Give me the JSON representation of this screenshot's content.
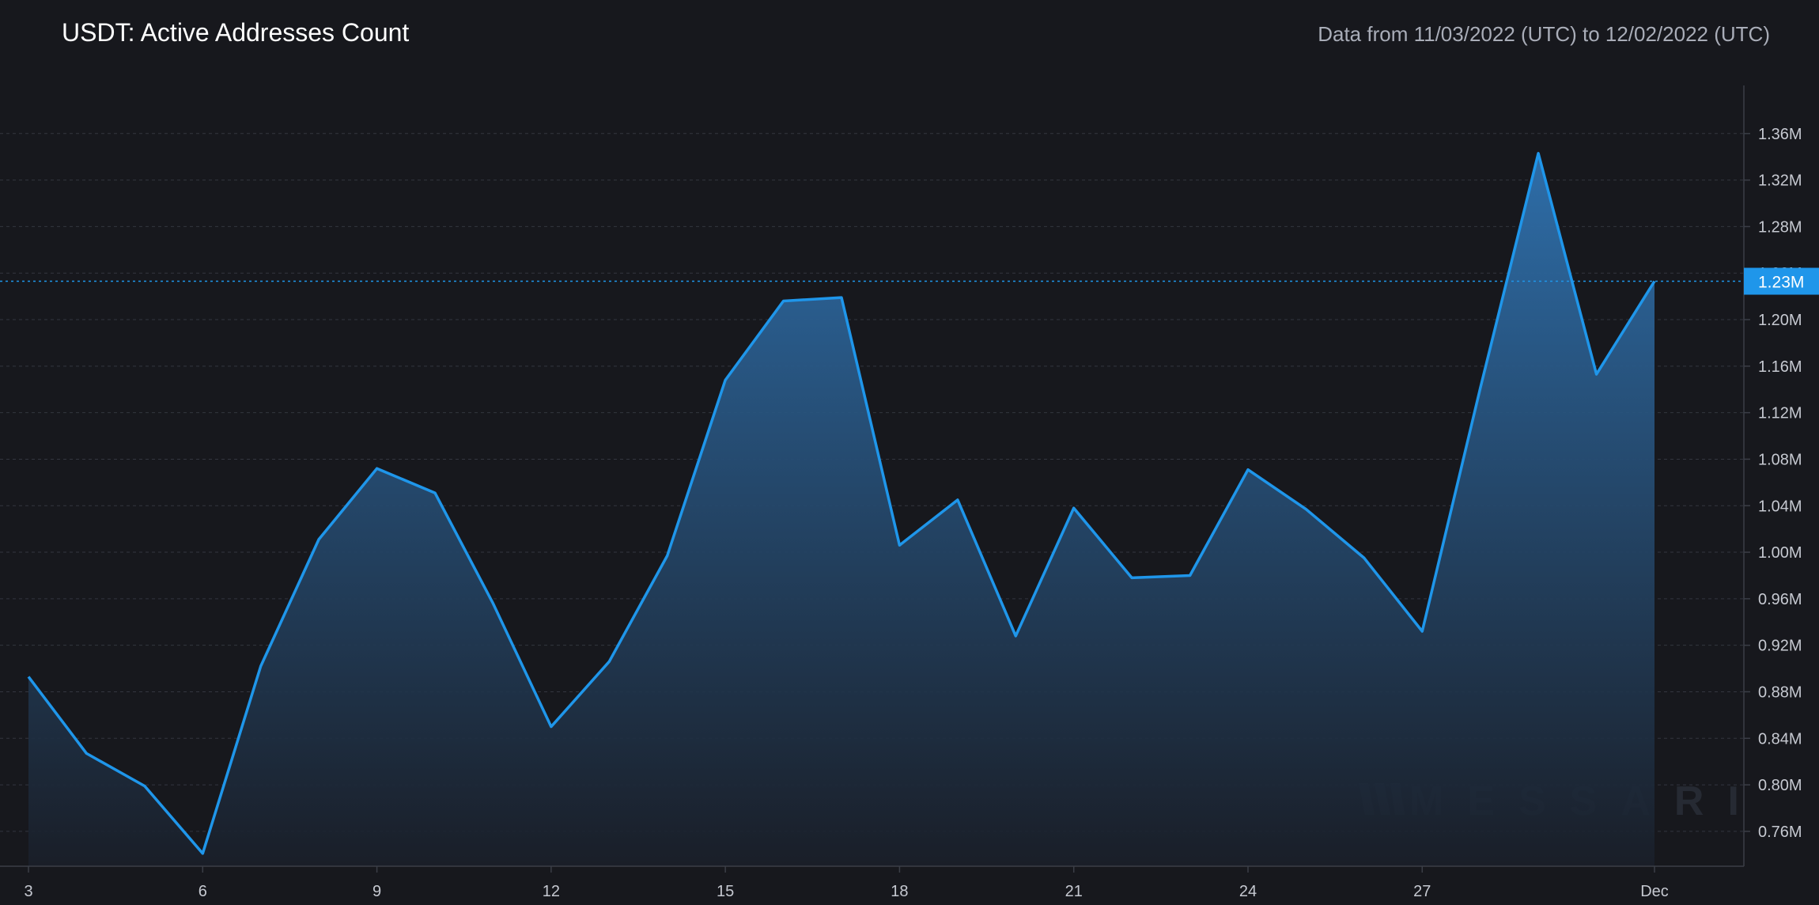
{
  "chart_data": {
    "type": "area",
    "title": "USDT: Active Addresses Count",
    "subtitle": "Data from 11/03/2022 (UTC) to 12/02/2022 (UTC)",
    "x": [
      "2022-11-03",
      "2022-11-04",
      "2022-11-05",
      "2022-11-06",
      "2022-11-07",
      "2022-11-08",
      "2022-11-09",
      "2022-11-10",
      "2022-11-11",
      "2022-11-12",
      "2022-11-13",
      "2022-11-14",
      "2022-11-15",
      "2022-11-16",
      "2022-11-17",
      "2022-11-18",
      "2022-11-19",
      "2022-11-20",
      "2022-11-21",
      "2022-11-22",
      "2022-11-23",
      "2022-11-24",
      "2022-11-25",
      "2022-11-26",
      "2022-11-27",
      "2022-11-28",
      "2022-11-29",
      "2022-11-30",
      "2022-12-01"
    ],
    "series": [
      {
        "values": [
          0.893,
          0.827,
          0.799,
          0.741,
          0.902,
          1.011,
          1.072,
          1.051,
          0.956,
          0.85,
          0.906,
          0.997,
          1.148,
          1.216,
          1.219,
          1.006,
          1.045,
          0.928,
          1.038,
          0.978,
          0.98,
          1.071,
          1.037,
          0.995,
          0.932,
          1.141,
          1.343,
          1.153,
          1.233
        ]
      }
    ],
    "y_unit": "M",
    "ylim": [
      0.73,
      1.4
    ],
    "y_ticks": [
      0.76,
      0.8,
      0.84,
      0.88,
      0.92,
      0.96,
      1.0,
      1.04,
      1.08,
      1.12,
      1.16,
      1.2,
      1.24,
      1.28,
      1.32,
      1.36
    ],
    "y_tick_labels": [
      "0.76M",
      "0.80M",
      "0.84M",
      "0.88M",
      "0.92M",
      "0.96M",
      "1.00M",
      "1.04M",
      "1.08M",
      "1.12M",
      "1.16M",
      "1.20M",
      "1.23M",
      "1.28M",
      "1.32M",
      "1.36M"
    ],
    "x_ticks": [
      "2022-11-03",
      "2022-11-06",
      "2022-11-09",
      "2022-11-12",
      "2022-11-15",
      "2022-11-18",
      "2022-11-21",
      "2022-11-24",
      "2022-11-27",
      "2022-12-01"
    ],
    "x_tick_labels": [
      "3",
      "6",
      "9",
      "12",
      "15",
      "18",
      "21",
      "24",
      "27",
      "Dec"
    ],
    "current_value": 1.233,
    "current_value_label": "1.23M",
    "grid": true,
    "legend": "none",
    "colors": {
      "background": "#17181d",
      "line": "#1f96ea",
      "fill_top": "#2f72b0",
      "fill_bottom": "#1a1f29"
    }
  },
  "watermark": {
    "text": "MESSARI",
    "icon": "messari-logo-icon"
  }
}
